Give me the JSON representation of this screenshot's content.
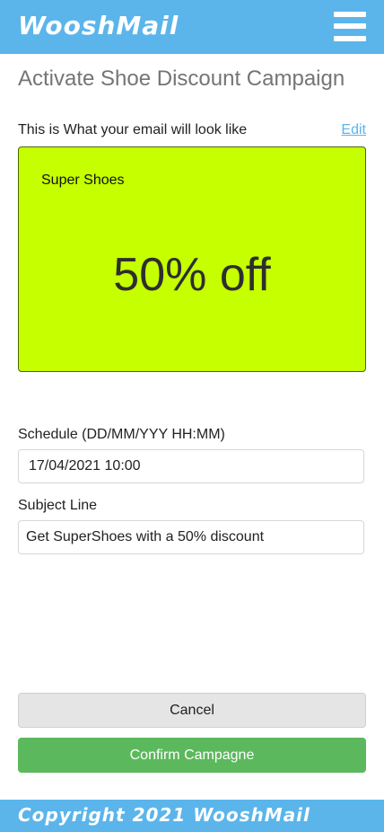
{
  "header": {
    "brand": "WooshMail",
    "menu_icon": "hamburger-menu-icon"
  },
  "page": {
    "title": "Activate Shoe Discount Campaign"
  },
  "preview": {
    "label": "This is What your email will look like",
    "edit_label": "Edit",
    "email": {
      "brand": "Super Shoes",
      "offer": "50% off",
      "background_color": "#c6ff00"
    }
  },
  "form": {
    "schedule_label": "Schedule (DD/MM/YYY HH:MM)",
    "schedule_value": "17/04/2021 10:00",
    "subject_label": "Subject Line",
    "subject_value": "Get SuperShoes with a 50% discount"
  },
  "actions": {
    "cancel_label": "Cancel",
    "confirm_label": "Confirm Campagne"
  },
  "footer": {
    "text": "Copyright 2021 WooshMail"
  },
  "colors": {
    "brand_blue": "#5bb5ea",
    "confirm_green": "#5cb85c"
  }
}
